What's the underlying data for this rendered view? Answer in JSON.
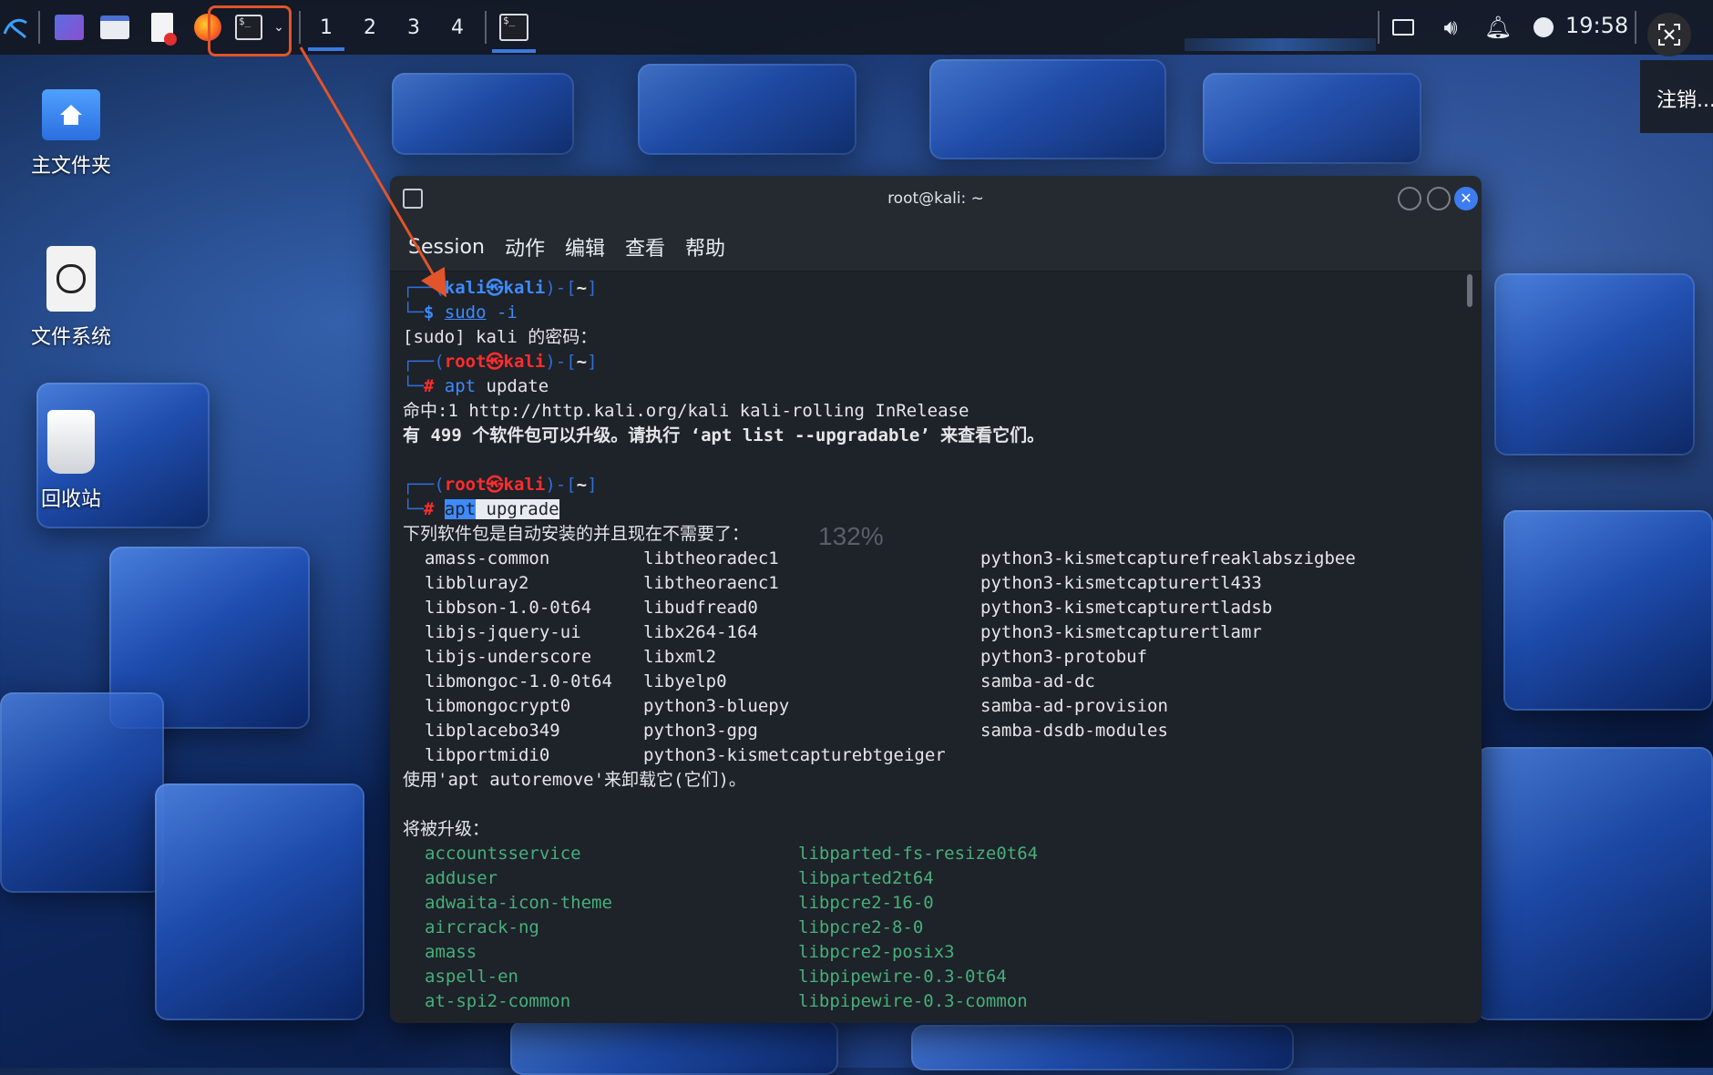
{
  "panel": {
    "workspaces": [
      "1",
      "2",
      "3",
      "4"
    ],
    "time": "19:58",
    "icons": [
      "kali-menu-icon",
      "show-desktop-icon",
      "file-manager-icon",
      "text-editor-icon",
      "firefox-icon",
      "terminal-icon",
      "dropdown-icon",
      "active-terminal-icon",
      "display-icon",
      "volume-icon",
      "notification-icon",
      "power-icon"
    ]
  },
  "desktop": {
    "home": "主文件夹",
    "filesystem": "文件系统",
    "trash": "回收站"
  },
  "logout": "注销...",
  "terminal": {
    "title": "root@kali: ~",
    "menu": [
      "Session",
      "动作",
      "编辑",
      "查看",
      "帮助"
    ],
    "lines": {
      "p1_user": "kali",
      "p1_host": "kali",
      "cmd1_a": "sudo",
      "cmd1_b": " -i",
      "sudo_prompt": "[sudo] kali 的密码：",
      "p2_user": "root",
      "p2_host": "kali",
      "cmd2_a": "apt",
      "cmd2_b": " update",
      "hit": "命中:1 http://http.kali.org/kali kali-rolling InRelease",
      "upgradable": "有 499 个软件包可以升级。请执行 ‘apt list --upgradable’ 来查看它们。",
      "p3_user": "root",
      "p3_host": "kali",
      "cmd3_a": "apt",
      "cmd3_b": " upgrade",
      "autoinstalled": "下列软件包是自动安装的并且现在不需要了：",
      "autoremove": "使用'apt autoremove'来卸载它(它们)。",
      "will_upgrade": "将被升级："
    },
    "zoom_overlay": "132%",
    "unneeded": [
      [
        "amass-common",
        "libtheoradec1",
        "python3-kismetcapturefreaklabszigbee"
      ],
      [
        "libbluray2",
        "libtheoraenc1",
        "python3-kismetcapturertl433"
      ],
      [
        "libbson-1.0-0t64",
        "libudfread0",
        "python3-kismetcapturertladsb"
      ],
      [
        "libjs-jquery-ui",
        "libx264-164",
        "python3-kismetcapturertlamr"
      ],
      [
        "libjs-underscore",
        "libxml2",
        "python3-protobuf"
      ],
      [
        "libmongoc-1.0-0t64",
        "libyelp0",
        "samba-ad-dc"
      ],
      [
        "libmongocrypt0",
        "python3-bluepy",
        "samba-ad-provision"
      ],
      [
        "libplacebo349",
        "python3-gpg",
        "samba-dsdb-modules"
      ],
      [
        "libportmidi0",
        "python3-kismetcapturebtgeiger",
        ""
      ]
    ],
    "upgrades": [
      [
        "accountsservice",
        "libparted-fs-resize0t64"
      ],
      [
        "adduser",
        "libparted2t64"
      ],
      [
        "adwaita-icon-theme",
        "libpcre2-16-0"
      ],
      [
        "aircrack-ng",
        "libpcre2-8-0"
      ],
      [
        "amass",
        "libpcre2-posix3"
      ],
      [
        "aspell-en",
        "libpipewire-0.3-0t64"
      ],
      [
        "at-spi2-common",
        "libpipewire-0.3-common"
      ]
    ]
  },
  "colors": {
    "accent": "#3a7be0",
    "prompt_blue": "#3d8bfd",
    "root_red": "#ff2d2d",
    "upgrade_green": "#46b07a",
    "annotation": "#e2542a"
  }
}
